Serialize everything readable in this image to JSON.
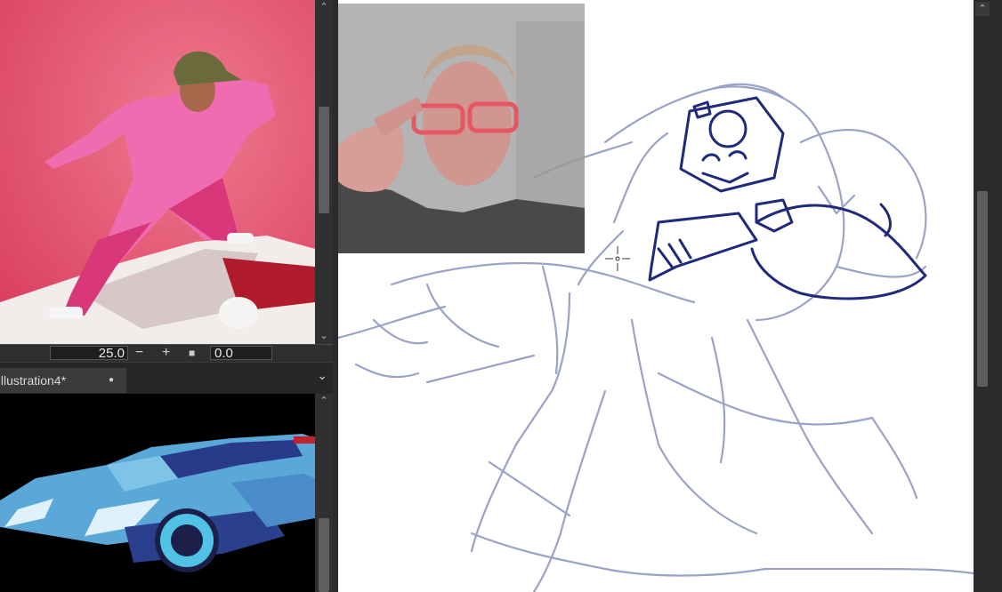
{
  "reference_panel": {
    "zoom_value": "25.0",
    "rotation_value": "0.0",
    "zoom_out_glyph": "−",
    "zoom_in_glyph": "+",
    "fit_glyph": "■"
  },
  "navigator": {
    "tab_label": "Illustration4*",
    "tab_modified_dot": "●",
    "menu_glyph": "⌄"
  },
  "scroll": {
    "up_glyph": "⌃",
    "down_glyph": "⌄"
  },
  "colors": {
    "ui_dark": "#2b2b2b",
    "panel": "#3a3a3a",
    "canvas": "#ffffff",
    "sketch_rough": "#9aa3c7",
    "sketch_ink": "#1f2a7a",
    "photo_bg": "#e0506e",
    "car_blue": "#5aa8d8"
  },
  "icons": [
    "brush-cursor-icon",
    "chevron-down-icon",
    "chevron-up-icon",
    "zoom-in-icon",
    "zoom-out-icon",
    "fit-icon"
  ]
}
